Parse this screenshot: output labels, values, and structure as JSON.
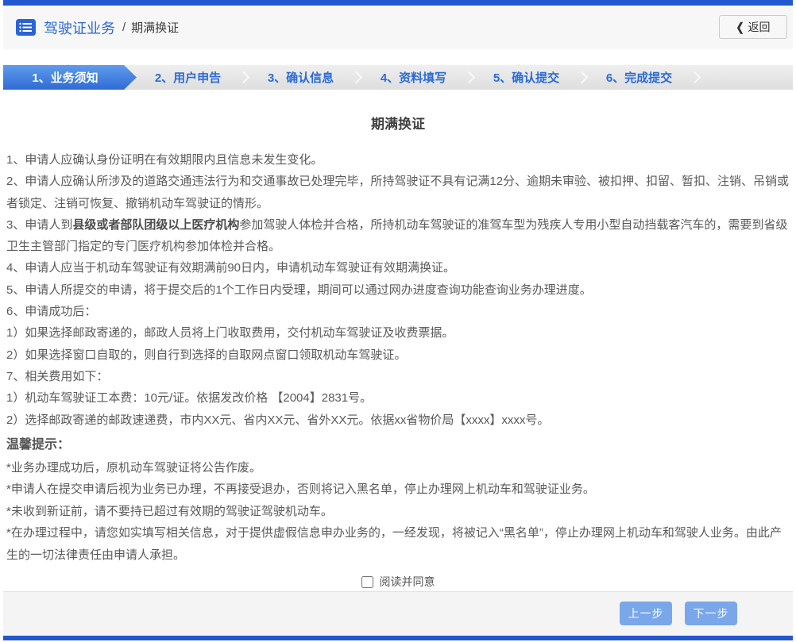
{
  "header": {
    "section_title": "驾驶证业务",
    "breadcrumb_separator": "/",
    "page_name": "期满换证",
    "back_label": "返回",
    "back_chevron": "❮"
  },
  "steps": [
    {
      "label": "1、业务须知",
      "active": true
    },
    {
      "label": "2、用户申告",
      "active": false
    },
    {
      "label": "3、确认信息",
      "active": false
    },
    {
      "label": "4、资料填写",
      "active": false
    },
    {
      "label": "5、确认提交",
      "active": false
    },
    {
      "label": "6、完成提交",
      "active": false
    }
  ],
  "content": {
    "title": "期满换证",
    "paragraphs": [
      [
        {
          "t": "1、申请人应确认身份证明在有效期限内且信息未发生变化。"
        }
      ],
      [
        {
          "t": "2、申请人应确认所涉及的道路交通违法行为和交通事故已处理完毕，所持驾驶证不具有记满12分、逾期未审验、被扣押、扣留、暂扣、注销、吊销或者锁定、注销可恢复、撤销机动车驾驶证的情形。"
        }
      ],
      [
        {
          "t": "3、申请人到"
        },
        {
          "t": "县级或者部队团级以上医疗机构",
          "b": true
        },
        {
          "t": "参加驾驶人体检并合格，所持机动车驾驶证的准驾车型为残疾人专用小型自动挡载客汽车的，需要到省级卫生主管部门指定的专门医疗机构参加体检并合格。"
        }
      ],
      [
        {
          "t": "4、申请人应当于机动车驾驶证有效期满前90日内，申请机动车驾驶证有效期满换证。"
        }
      ],
      [
        {
          "t": "5、申请人所提交的申请，将于提交后的1个工作日内受理，期间可以通过网办进度查询功能查询业务办理进度。"
        }
      ],
      [
        {
          "t": "6、申请成功后："
        }
      ],
      [
        {
          "t": "1）如果选择邮政寄递的，邮政人员将上门收取费用，交付机动车驾驶证及收费票据。"
        }
      ],
      [
        {
          "t": "2）如果选择窗口自取的，则自行到选择的自取网点窗口领取机动车驾驶证。"
        }
      ],
      [
        {
          "t": "7、相关费用如下："
        }
      ],
      [
        {
          "t": "1）机动车驾驶证工本费：10元/证。依据发改价格 【2004】2831号。"
        }
      ],
      [
        {
          "t": "2）选择邮政寄递的邮政速递费，市内XX元、省内XX元、省外XX元。依据xx省物价局【xxxx】xxxx号。"
        }
      ]
    ],
    "notice_title": "温馨提示：",
    "notices": [
      "*业务办理成功后，原机动车驾驶证将公告作废。",
      "*申请人在提交申请后视为业务已办理，不再接受退办，否则将记入黑名单，停止办理网上机动车和驾驶证业务。",
      "*未收到新证前，请不要持已超过有效期的驾驶证驾驶机动车。",
      "*在办理过程中，请您如实填写相关信息，对于提供虚假信息申办业务的，一经发现，将被记入“黑名单”，停止办理网上机动车和驾驶人业务。由此产生的一切法律责任由申请人承担。"
    ],
    "agree_label": "阅读并同意",
    "agree_checked": false
  },
  "footer": {
    "prev_label": "上一步",
    "next_label": "下一步"
  },
  "colors": {
    "accent_blue": "#2257ce",
    "link_blue": "#2a69d5",
    "tab_active_top": "#5f9ced",
    "tab_active_bottom": "#2f6bd2",
    "button_blue": "#7aa7e9",
    "footer_gray": "#f4f4f4",
    "header_gray": "#f7f7f8",
    "text_gray": "#5a5a5a"
  }
}
